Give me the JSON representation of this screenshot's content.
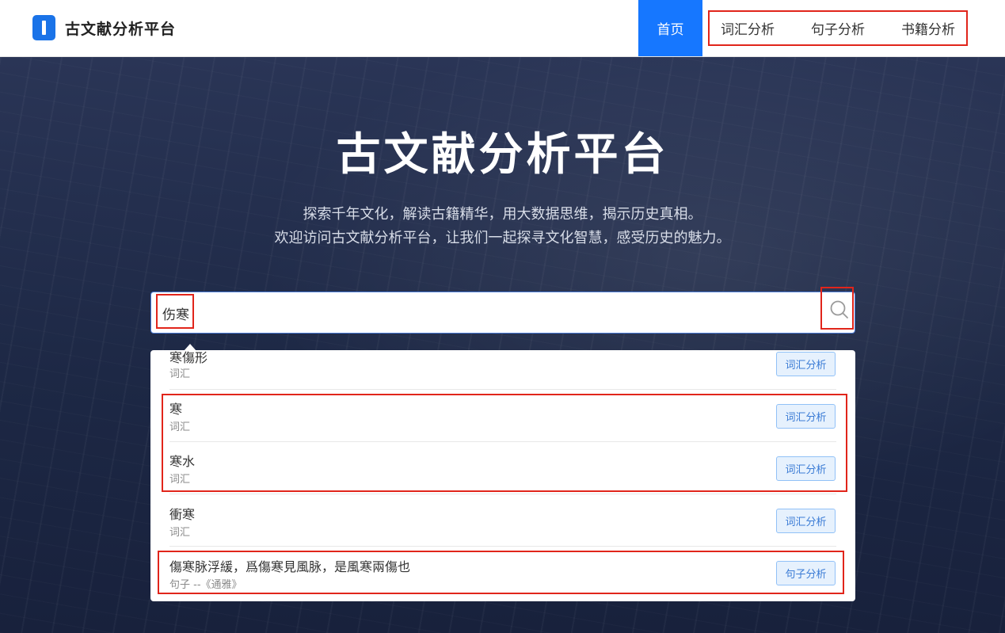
{
  "header": {
    "logo_text": "古文献分析平台",
    "nav": {
      "home": "首页",
      "vocab": "词汇分析",
      "sentence": "句子分析",
      "books": "书籍分析"
    }
  },
  "hero": {
    "title": "古文献分析平台",
    "subtitle_line1": "探索千年文化，解读古籍精华，用大数据思维，揭示历史真相。",
    "subtitle_line2": "欢迎访问古文献分析平台，让我们一起探寻文化智慧，感受历史的魅力。"
  },
  "search": {
    "value": "伤寒"
  },
  "results": [
    {
      "title": "寒傷形",
      "type": "词汇",
      "button": "词汇分析"
    },
    {
      "title": "寒",
      "type": "词汇",
      "button": "词汇分析"
    },
    {
      "title": "寒水",
      "type": "词汇",
      "button": "词汇分析"
    },
    {
      "title": "衝寒",
      "type": "词汇",
      "button": "词汇分析"
    },
    {
      "title": "傷寒脉浮緩，爲傷寒見風脉，是風寒兩傷也",
      "type": "句子 --《通雅》",
      "button": "句子分析"
    }
  ],
  "colors": {
    "accent": "#1677ff",
    "highlight_box": "#e1251b"
  }
}
